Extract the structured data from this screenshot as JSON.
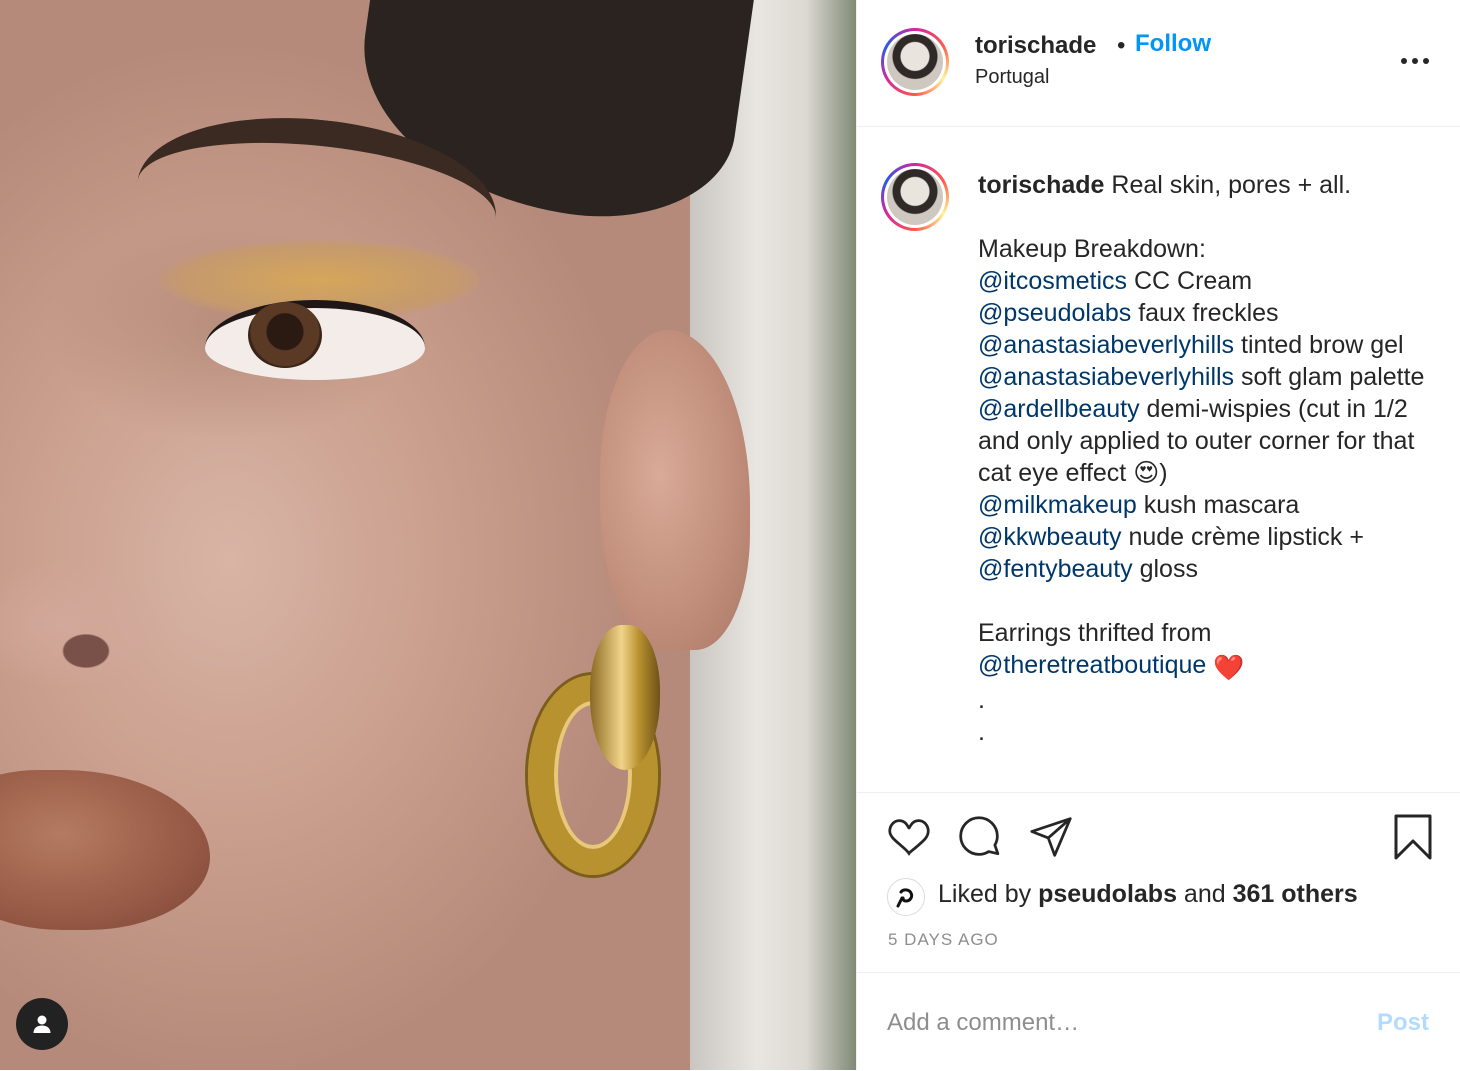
{
  "post": {
    "author": "torischade",
    "follow_label": "Follow",
    "separator": "•",
    "location": "Portugal"
  },
  "caption": {
    "username": "torischade",
    "line1": " Real skin, pores + all.",
    "heading": "Makeup Breakdown:",
    "items": [
      {
        "mention": "@itcosmetics",
        "text": " CC Cream"
      },
      {
        "mention": "@pseudolabs",
        "text": " faux freckles"
      },
      {
        "mention": "@anastasiabeverlyhills",
        "text": " tinted brow gel"
      },
      {
        "mention": "@anastasiabeverlyhills",
        "text": " soft glam palette"
      },
      {
        "mention": "@ardellbeauty",
        "text": " demi-wispies (cut in 1/2 and only applied to outer corner for that cat eye effect 😍)"
      },
      {
        "mention": "@milkmakeup",
        "text": " kush mascara"
      },
      {
        "mention": "@kkwbeauty",
        "text": " nude crème lipstick +"
      },
      {
        "mention": "@fentybeauty",
        "text": " gloss"
      }
    ],
    "earrings_text": "Earrings thrifted from",
    "earrings_mention": "@theretreatboutique",
    "earrings_emoji": "❤️",
    "dots": [
      ".",
      "."
    ]
  },
  "engagement": {
    "liked_by_prefix": "Liked by ",
    "liked_by_user": "pseudolabs",
    "and_label": " and ",
    "others": "361 others",
    "timestamp": "5 DAYS AGO"
  },
  "comment": {
    "placeholder": "Add a comment…",
    "post_label": "Post"
  },
  "colors": {
    "link_blue": "#0095f6",
    "mention": "#00376b",
    "post_disabled": "#b3dbff",
    "muted": "#8e8e8e"
  },
  "icons": [
    "user-tag-icon",
    "more-options-icon",
    "heart-icon",
    "comment-icon",
    "share-icon",
    "bookmark-icon"
  ]
}
